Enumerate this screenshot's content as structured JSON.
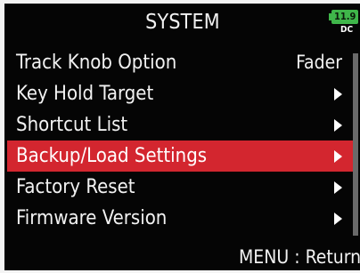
{
  "header": {
    "title": "SYSTEM",
    "battery_level": "11.9",
    "power_source": "DC",
    "battery_color": "#3fb64a"
  },
  "menu": {
    "items": [
      {
        "label": "Track Knob Option",
        "value": "Fader",
        "has_submenu": false,
        "selected": false
      },
      {
        "label": "Key Hold Target",
        "value": "",
        "has_submenu": true,
        "selected": false
      },
      {
        "label": "Shortcut List",
        "value": "",
        "has_submenu": true,
        "selected": false
      },
      {
        "label": "Backup/Load Settings",
        "value": "",
        "has_submenu": true,
        "selected": true
      },
      {
        "label": "Factory Reset",
        "value": "",
        "has_submenu": true,
        "selected": false
      },
      {
        "label": "Firmware Version",
        "value": "",
        "has_submenu": true,
        "selected": false
      }
    ],
    "selected_color": "#d3262f"
  },
  "footer": {
    "hint": "MENU : Return"
  },
  "icons": {
    "submenu": "chevron-right-icon",
    "battery": "battery-icon"
  }
}
